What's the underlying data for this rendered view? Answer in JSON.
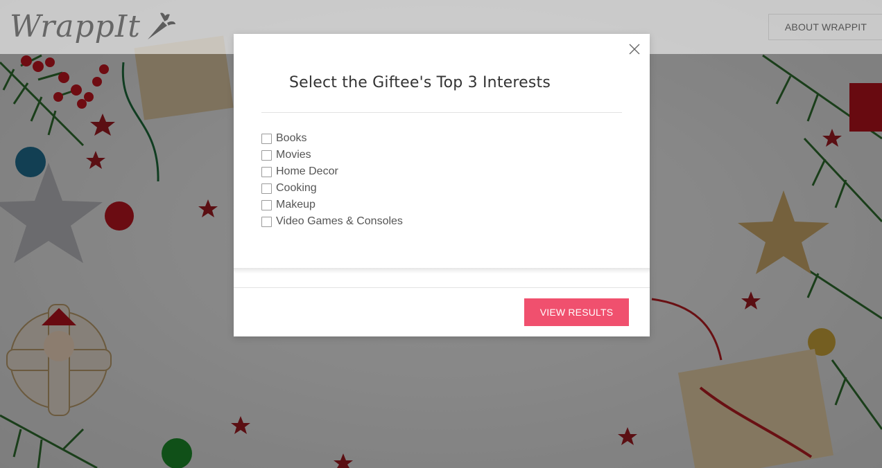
{
  "header": {
    "logo_text": "WrappIt",
    "about_label": "ABOUT WRAPPIT"
  },
  "modal": {
    "title": "Select the Giftee's Top 3 Interests",
    "options": [
      {
        "label": "Books",
        "checked": false
      },
      {
        "label": "Movies",
        "checked": false
      },
      {
        "label": "Home Decor",
        "checked": false
      },
      {
        "label": "Cooking",
        "checked": false
      },
      {
        "label": "Makeup",
        "checked": false
      },
      {
        "label": "Video Games & Consoles",
        "checked": false
      }
    ],
    "submit_label": "VIEW RESULTS",
    "close_icon": "close-icon"
  },
  "colors": {
    "accent": "#f0506e",
    "overlay": "rgba(0,0,0,0.42)"
  }
}
